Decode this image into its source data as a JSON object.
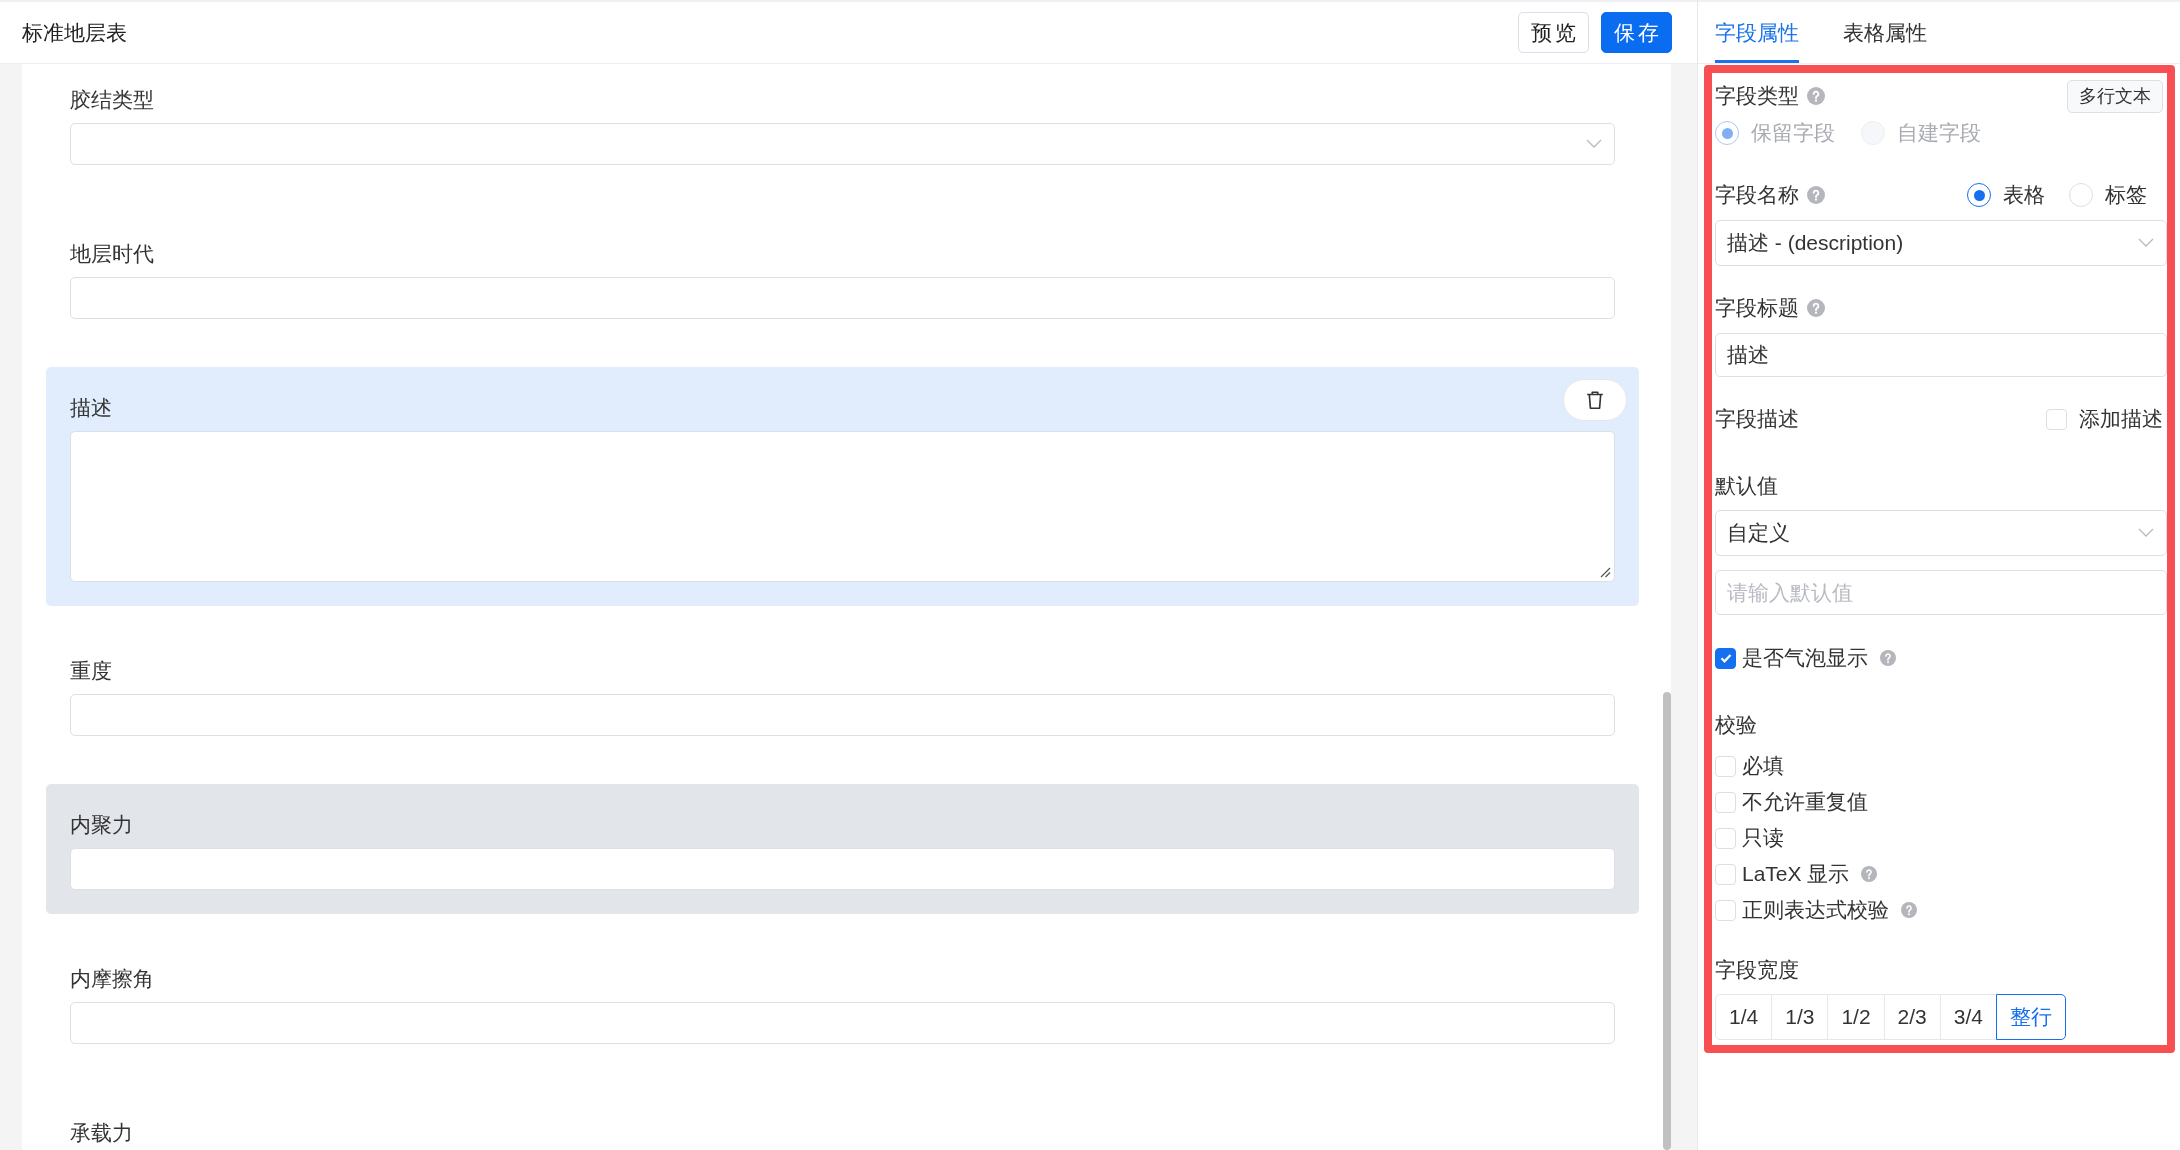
{
  "header": {
    "title": "标准地层表",
    "buttons": [
      {
        "label": "预览",
        "kind": "default"
      },
      {
        "label": "保存",
        "kind": "primary"
      }
    ]
  },
  "form": {
    "fields": [
      {
        "label": "胶结类型",
        "kind": "select",
        "selected": false,
        "hovered": false
      },
      {
        "label": "地层时代",
        "kind": "input",
        "selected": false,
        "hovered": false
      },
      {
        "label": "描述",
        "kind": "textarea",
        "selected": true,
        "hovered": false
      },
      {
        "label": "重度",
        "kind": "input",
        "selected": false,
        "hovered": false
      },
      {
        "label": "内聚力",
        "kind": "input",
        "selected": false,
        "hovered": true
      },
      {
        "label": "内摩擦角",
        "kind": "input",
        "selected": false,
        "hovered": false
      },
      {
        "label": "承载力",
        "selected": false,
        "hovered": false
      }
    ]
  },
  "properties": {
    "tabs": [
      {
        "label": "字段属性",
        "selected": true
      },
      {
        "label": "表格属性",
        "selected": false
      }
    ],
    "highlighted": true,
    "field_type": {
      "label": "字段类型",
      "help": true,
      "type_tag": "多行文本",
      "disabled": true,
      "options": [
        {
          "label": "保留字段",
          "selected": true
        },
        {
          "label": "自建字段",
          "selected": false
        }
      ]
    },
    "field_name": {
      "label": "字段名称",
      "help": true,
      "options": [
        {
          "label": "表格",
          "selected": true
        },
        {
          "label": "标签",
          "selected": false
        }
      ],
      "value": "描述 - (description)"
    },
    "field_title": {
      "label": "字段标题",
      "help": true,
      "value": "描述"
    },
    "field_description": {
      "label": "字段描述",
      "option": {
        "label": "添加描述",
        "checked": false
      }
    },
    "default_value": {
      "label": "默认值",
      "mode": "自定义",
      "placeholder": "请输入默认值"
    },
    "bubble_display": {
      "label": "是否气泡显示",
      "checked": true,
      "help": true
    },
    "validation": {
      "label": "校验",
      "rules": [
        {
          "label": "必填",
          "checked": false,
          "help": false
        },
        {
          "label": "不允许重复值",
          "checked": false,
          "help": false
        },
        {
          "label": "只读",
          "checked": false,
          "help": false
        },
        {
          "label": "LaTeX 显示",
          "checked": false,
          "help": true
        },
        {
          "label": "正则表达式校验",
          "checked": false,
          "help": true
        }
      ]
    },
    "field_width": {
      "label": "字段宽度",
      "options": [
        {
          "label": "1/4",
          "selected": false
        },
        {
          "label": "1/3",
          "selected": false
        },
        {
          "label": "1/2",
          "selected": false
        },
        {
          "label": "2/3",
          "selected": false
        },
        {
          "label": "3/4",
          "selected": false
        },
        {
          "label": "整行",
          "selected": true
        }
      ]
    }
  }
}
